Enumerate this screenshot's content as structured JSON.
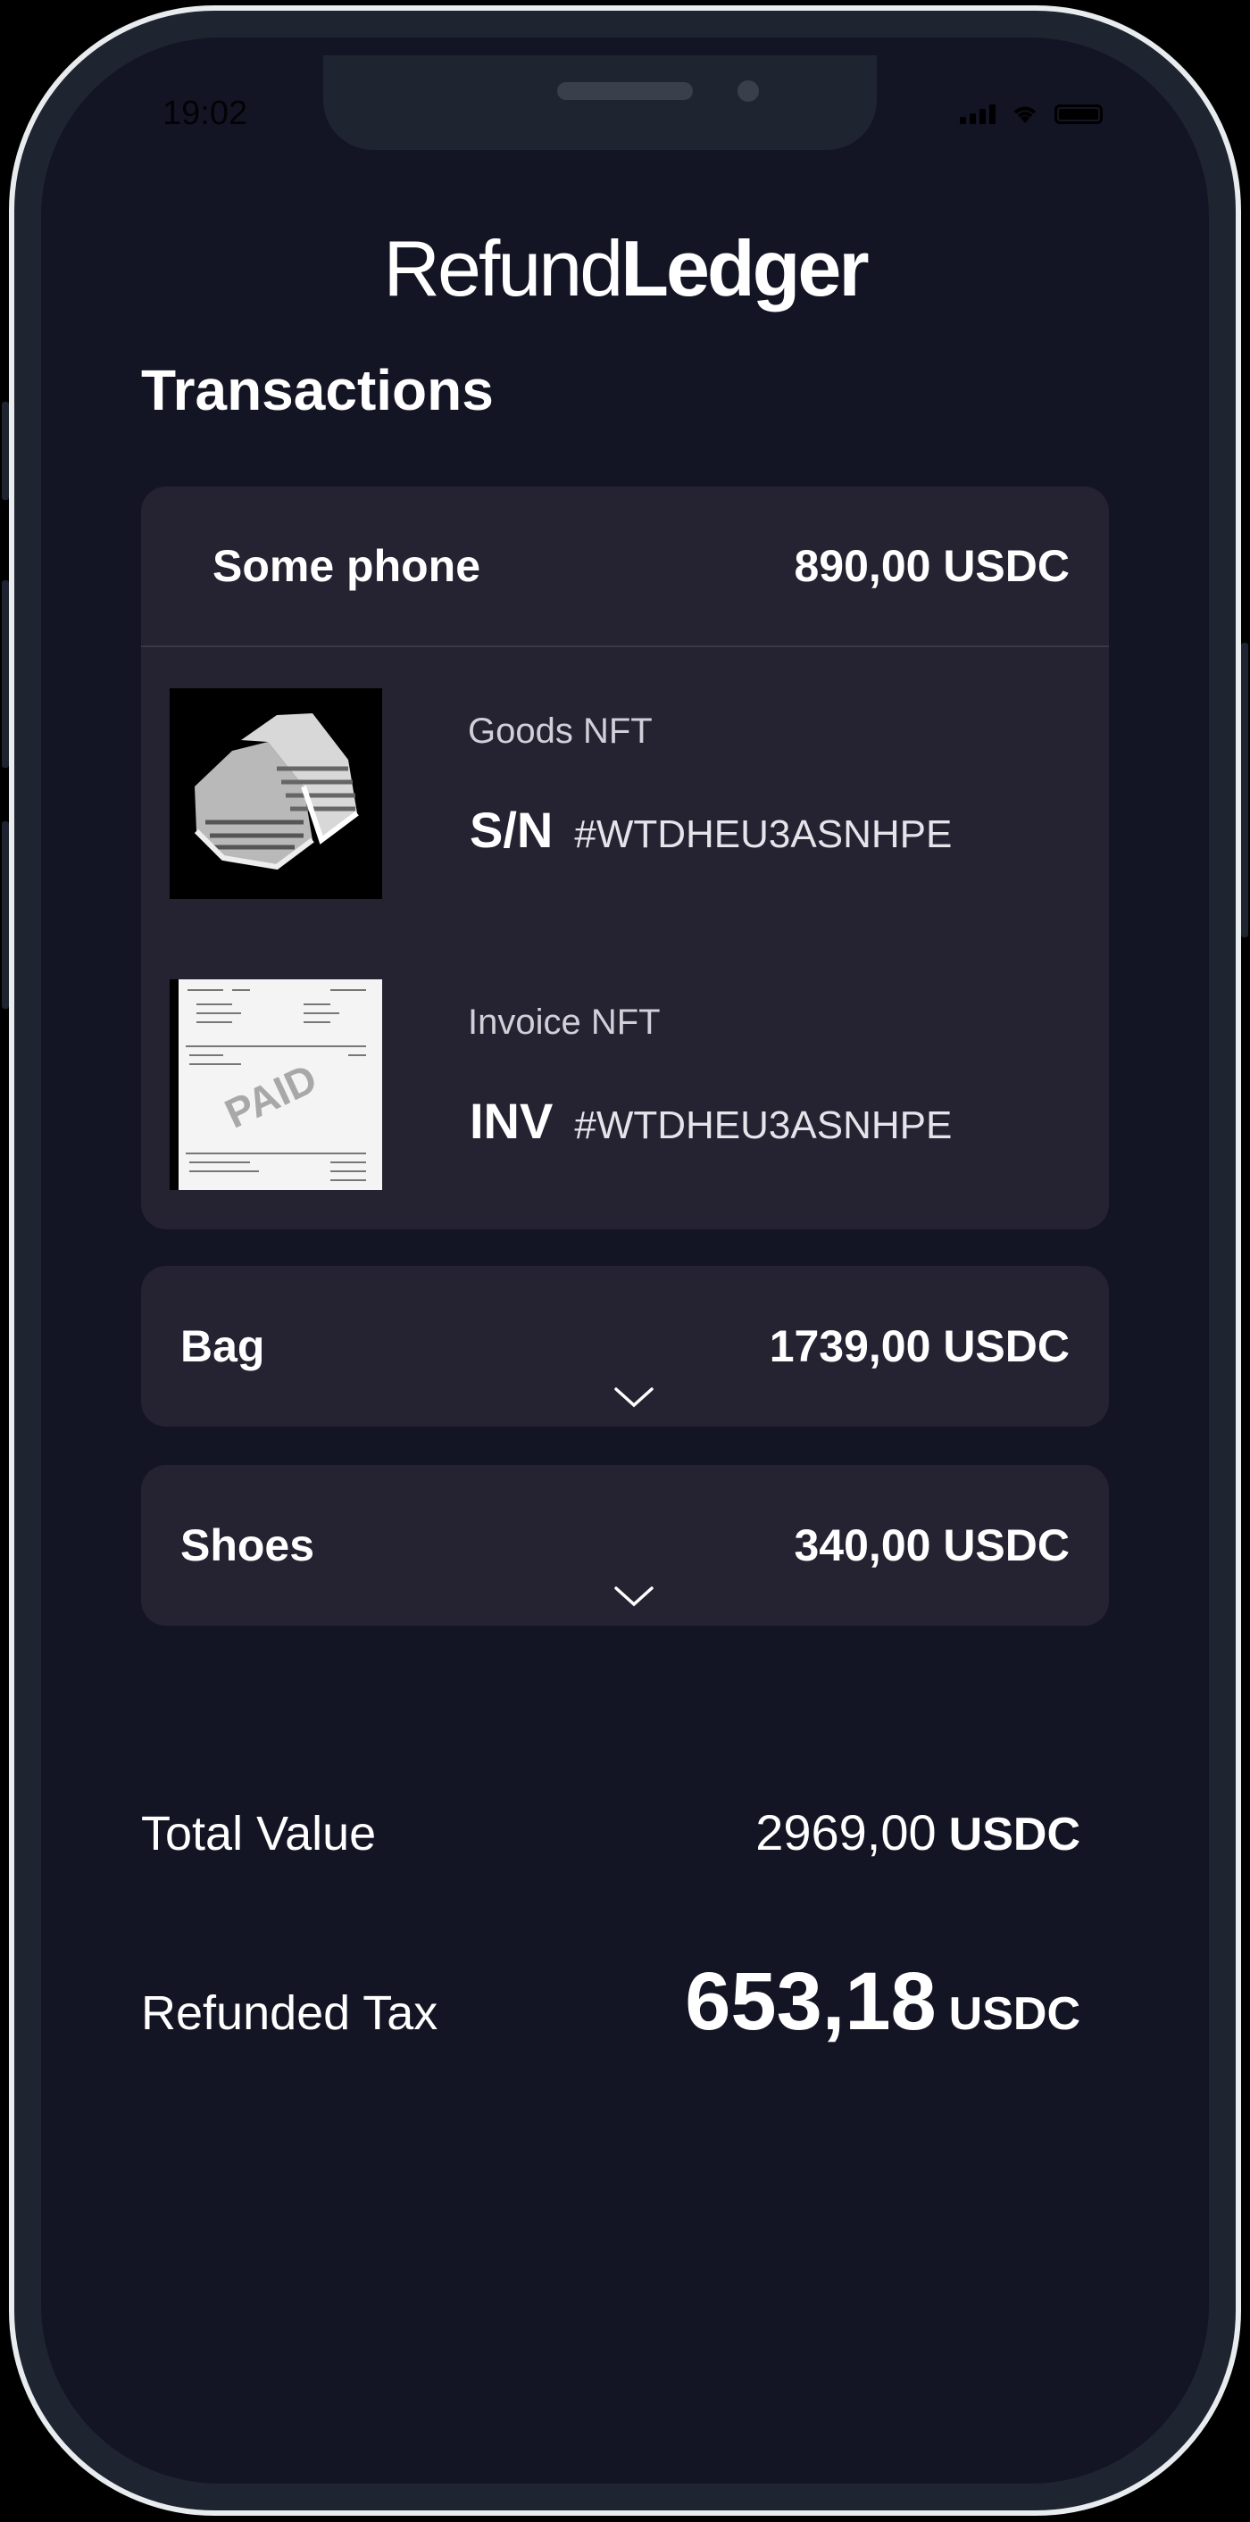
{
  "status": {
    "time": "19:02"
  },
  "brand": {
    "light": "Refund",
    "bold": "Ledger"
  },
  "page_title": "Transactions",
  "items": [
    {
      "name": "Some phone",
      "price": "890,00 USDC",
      "nfts": [
        {
          "type": "Goods NFT",
          "prefix": "S/N",
          "hash": "#WTDHEU3ASNHPE",
          "image": "sneakers-image"
        },
        {
          "type": "Invoice NFT",
          "prefix": "INV",
          "hash": "#WTDHEU3ASNHPE",
          "image": "paid-invoice-image",
          "stamp": "PAID"
        }
      ]
    },
    {
      "name": "Bag",
      "price": "1739,00 USDC"
    },
    {
      "name": "Shoes",
      "price": "340,00 USDC"
    }
  ],
  "totals": {
    "total_label": "Total Value",
    "total_amount": "2969,00",
    "total_unit": "USDC",
    "refund_label": "Refunded Tax",
    "refund_amount": "653,18",
    "refund_unit": "USDC"
  },
  "icons": {
    "collapse": "chevron-down-icon"
  }
}
